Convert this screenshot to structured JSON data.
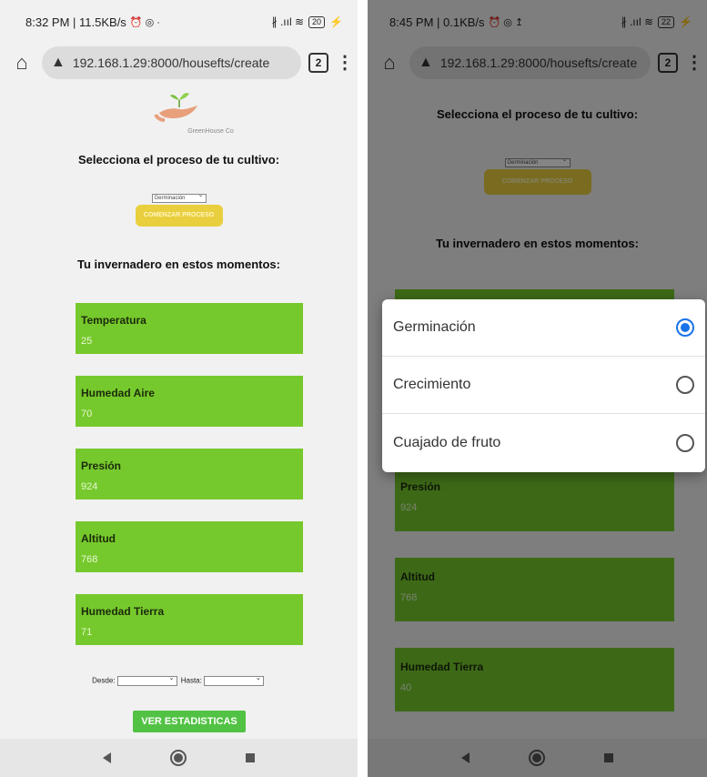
{
  "left": {
    "status": {
      "time": "8:32 PM | 11.5KB/s",
      "icons": "⏰ ◎ ·",
      "signal": "∦ .ııl ≋",
      "battery": "20"
    },
    "browser": {
      "url": "192.168.1.29:8000/housefts/create",
      "tab_count": "2"
    },
    "logo_text": "GreenHouse Co",
    "process_heading": "Selecciona el proceso de tu cultivo:",
    "process_select": "Germinación",
    "start_button": "COMENZAR PROCESO",
    "now_heading": "Tu invernadero en estos momentos:",
    "cards": [
      {
        "label": "Temperatura",
        "value": "25"
      },
      {
        "label": "Humedad Aire",
        "value": "70"
      },
      {
        "label": "Presión",
        "value": "924"
      },
      {
        "label": "Altitud",
        "value": "768"
      },
      {
        "label": "Humedad Tierra",
        "value": "71"
      }
    ],
    "date_from_label": "Desde:",
    "date_to_label": "Hasta:",
    "stats_button": "VER ESTADISTICAS"
  },
  "right": {
    "status": {
      "time": "8:45 PM | 0.1KB/s",
      "icons": "⏰ ◎ ↥",
      "signal": "∦ .ııl ≋",
      "battery": "22"
    },
    "browser": {
      "url": "192.168.1.29:8000/housefts/create",
      "tab_count": "2"
    },
    "process_heading": "Selecciona el proceso de tu cultivo:",
    "process_select": "Germinación",
    "start_button": "COMENZAR PROCESO",
    "now_heading": "Tu invernadero en estos momentos:",
    "cards": [
      {
        "label": "Presión",
        "value": "924"
      },
      {
        "label": "Altitud",
        "value": "768"
      },
      {
        "label": "Humedad Tierra",
        "value": "40"
      }
    ],
    "options": [
      {
        "label": "Germinación",
        "selected": true
      },
      {
        "label": "Crecimiento",
        "selected": false
      },
      {
        "label": "Cuajado de fruto",
        "selected": false
      }
    ]
  },
  "colors": {
    "card_green": "#76c92c",
    "button_yellow": "#e9cf3e",
    "button_green": "#52c244",
    "radio_blue": "#1a73e8"
  }
}
